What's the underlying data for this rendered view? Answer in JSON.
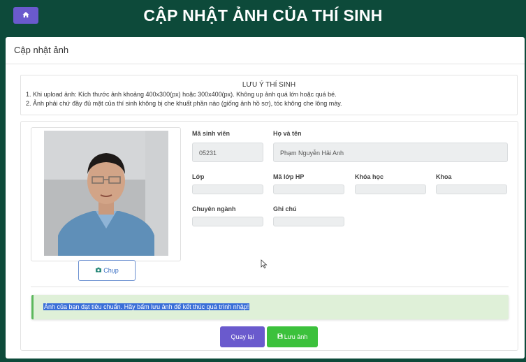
{
  "header": {
    "title": "CẬP NHẬT ẢNH CỦA THÍ SINH",
    "home_icon": "home-icon"
  },
  "panel": {
    "title": "Cập nhật ảnh"
  },
  "notice": {
    "title": "LƯU Ý THÍ SINH",
    "lines": [
      "1. Khi upload ảnh: Kích thước ảnh khoảng 400x300(px) hoặc 300x400(px). Không up ảnh quá lớn hoặc quá bé.",
      "2. Ảnh phải chứ đầy đủ mặt của thí sinh không bị che khuất phần nào (giống ảnh hồ sơ), tóc không che lông mày."
    ]
  },
  "capture": {
    "label": "Chụp",
    "icon": "camera-icon"
  },
  "fields": {
    "student_id": {
      "label": "Mã sinh viên",
      "value": "05231"
    },
    "full_name": {
      "label": "Họ và tên",
      "value": "Phạm Nguyễn Hải Anh"
    },
    "class": {
      "label": "Lớp",
      "value": ""
    },
    "course_class_id": {
      "label": "Mã lớp HP",
      "value": ""
    },
    "cohort": {
      "label": "Khóa học",
      "value": ""
    },
    "faculty": {
      "label": "Khoa",
      "value": ""
    },
    "major": {
      "label": "Chuyên ngành",
      "value": ""
    },
    "note": {
      "label": "Ghi chú",
      "value": ""
    }
  },
  "alert": {
    "text": "Ảnh của bạn đạt tiêu chuẩn. Hãy bấm lưu ảnh để kết thúc quá trình nhập!"
  },
  "actions": {
    "back_label": "Quay lại",
    "save_label": "Lưu ảnh",
    "save_icon": "floppy-disk-icon"
  },
  "colors": {
    "background": "#0d4a3a",
    "primary": "#6a5acd",
    "success": "#3cc13c",
    "alert_bg": "#dff0d8"
  }
}
